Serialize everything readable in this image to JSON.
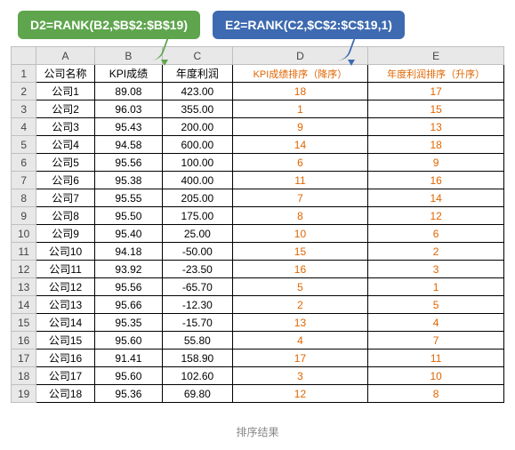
{
  "formulas": {
    "d2": "D2=RANK(B2,$B$2:$B$19)",
    "e2": "E2=RANK(C2,$C$2:$C$19,1)"
  },
  "columns": [
    "A",
    "B",
    "C",
    "D",
    "E"
  ],
  "headers": {
    "a": "公司名称",
    "b": "KPI成绩",
    "c": "年度利润",
    "d": "KPI成绩排序（降序）",
    "e": "年度利润排序（升序）"
  },
  "rows": [
    {
      "n": "2",
      "a": "公司1",
      "b": "89.08",
      "c": "423.00",
      "d": "18",
      "e": "17"
    },
    {
      "n": "3",
      "a": "公司2",
      "b": "96.03",
      "c": "355.00",
      "d": "1",
      "e": "15"
    },
    {
      "n": "4",
      "a": "公司3",
      "b": "95.43",
      "c": "200.00",
      "d": "9",
      "e": "13"
    },
    {
      "n": "5",
      "a": "公司4",
      "b": "94.58",
      "c": "600.00",
      "d": "14",
      "e": "18"
    },
    {
      "n": "6",
      "a": "公司5",
      "b": "95.56",
      "c": "100.00",
      "d": "6",
      "e": "9"
    },
    {
      "n": "7",
      "a": "公司6",
      "b": "95.38",
      "c": "400.00",
      "d": "11",
      "e": "16"
    },
    {
      "n": "8",
      "a": "公司7",
      "b": "95.55",
      "c": "205.00",
      "d": "7",
      "e": "14"
    },
    {
      "n": "9",
      "a": "公司8",
      "b": "95.50",
      "c": "175.00",
      "d": "8",
      "e": "12"
    },
    {
      "n": "10",
      "a": "公司9",
      "b": "95.40",
      "c": "25.00",
      "d": "10",
      "e": "6"
    },
    {
      "n": "11",
      "a": "公司10",
      "b": "94.18",
      "c": "-50.00",
      "d": "15",
      "e": "2"
    },
    {
      "n": "12",
      "a": "公司11",
      "b": "93.92",
      "c": "-23.50",
      "d": "16",
      "e": "3"
    },
    {
      "n": "13",
      "a": "公司12",
      "b": "95.56",
      "c": "-65.70",
      "d": "5",
      "e": "1"
    },
    {
      "n": "14",
      "a": "公司13",
      "b": "95.66",
      "c": "-12.30",
      "d": "2",
      "e": "5"
    },
    {
      "n": "15",
      "a": "公司14",
      "b": "95.35",
      "c": "-15.70",
      "d": "13",
      "e": "4"
    },
    {
      "n": "16",
      "a": "公司15",
      "b": "95.60",
      "c": "55.80",
      "d": "4",
      "e": "7"
    },
    {
      "n": "17",
      "a": "公司16",
      "b": "91.41",
      "c": "158.90",
      "d": "17",
      "e": "11"
    },
    {
      "n": "18",
      "a": "公司17",
      "b": "95.60",
      "c": "102.60",
      "d": "3",
      "e": "10"
    },
    {
      "n": "19",
      "a": "公司18",
      "b": "95.36",
      "c": "69.80",
      "d": "12",
      "e": "8"
    }
  ],
  "caption": "排序结果",
  "chart_data": {
    "type": "table",
    "title": "排序结果",
    "columns": [
      "公司名称",
      "KPI成绩",
      "年度利润",
      "KPI成绩排序（降序）",
      "年度利润排序（升序）"
    ],
    "data": [
      [
        "公司1",
        89.08,
        423.0,
        18,
        17
      ],
      [
        "公司2",
        96.03,
        355.0,
        1,
        15
      ],
      [
        "公司3",
        95.43,
        200.0,
        9,
        13
      ],
      [
        "公司4",
        94.58,
        600.0,
        14,
        18
      ],
      [
        "公司5",
        95.56,
        100.0,
        6,
        9
      ],
      [
        "公司6",
        95.38,
        400.0,
        11,
        16
      ],
      [
        "公司7",
        95.55,
        205.0,
        7,
        14
      ],
      [
        "公司8",
        95.5,
        175.0,
        8,
        12
      ],
      [
        "公司9",
        95.4,
        25.0,
        10,
        6
      ],
      [
        "公司10",
        94.18,
        -50.0,
        15,
        2
      ],
      [
        "公司11",
        93.92,
        -23.5,
        16,
        3
      ],
      [
        "公司12",
        95.56,
        -65.7,
        5,
        1
      ],
      [
        "公司13",
        95.66,
        -12.3,
        2,
        5
      ],
      [
        "公司14",
        95.35,
        -15.7,
        13,
        4
      ],
      [
        "公司15",
        95.6,
        55.8,
        4,
        7
      ],
      [
        "公司16",
        91.41,
        158.9,
        17,
        11
      ],
      [
        "公司17",
        95.6,
        102.6,
        3,
        10
      ],
      [
        "公司18",
        95.36,
        69.8,
        12,
        8
      ]
    ]
  }
}
